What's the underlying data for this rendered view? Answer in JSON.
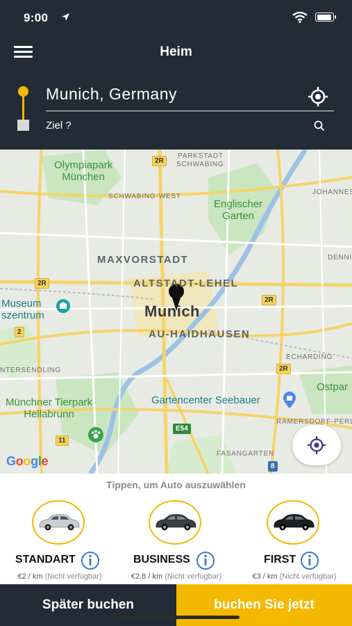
{
  "status_bar": {
    "time": "9:00"
  },
  "nav": {
    "title": "Heim"
  },
  "route": {
    "origin_value": "Munich, Germany",
    "destination_placeholder": "Ziel ?"
  },
  "map": {
    "labels": {
      "parkstadt": "PARKSTADT",
      "schwabing": "SCHWABING",
      "olympiapark": "Olympiapark\nMünchen",
      "schwabing_west": "SCHWABING-WEST",
      "englischer_garten": "Englischer\nGarten",
      "johanneskirchen": "JOHANNES",
      "maxvorstadt": "MAXVORSTADT",
      "altstadt_lehel": "ALTSTADT-LEHEL",
      "denning": "DENNI",
      "museum": "Museum\nszentrum",
      "munich": "Munich",
      "au_haidhausen": "AU-HAIDHAUSEN",
      "echarding": "ECHARDING",
      "sendling": "NTERSENDLING",
      "ostpark": "Ostpar",
      "tierpark": "Münchner Tierpark\nHellabrunn",
      "gartencenter": "Gartencenter Seebauer",
      "ramersdorf": "RAMERSDORF-PERL",
      "fasangarten": "FASANGARTEN"
    },
    "road_badges": [
      "2R",
      "2R",
      "2R",
      "2R",
      "2",
      "11",
      "E54",
      "8"
    ],
    "attribution": "Google"
  },
  "sheet": {
    "hint": "Tippen, um Auto auszuwählen",
    "cars": [
      {
        "name": "STANDART",
        "price": "€2 / km",
        "availability": "(Nicht verfügbar)"
      },
      {
        "name": "BUSINESS",
        "price": "€2.8 / km",
        "availability": "(Nicht verfügbar)"
      },
      {
        "name": "FIRST",
        "price": "€3 / km",
        "availability": "(Nicht verfügbar)"
      }
    ]
  },
  "footer": {
    "later_label": "Später buchen",
    "now_label": "buchen Sie jetzt"
  },
  "colors": {
    "header_bg": "#222b36",
    "accent": "#f5b800",
    "map_bg": "#e8eae4"
  }
}
